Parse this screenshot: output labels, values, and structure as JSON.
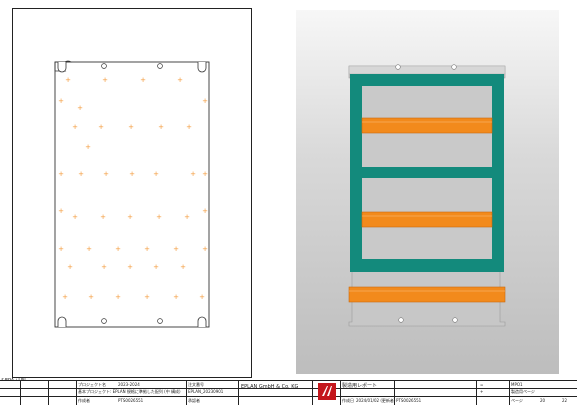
{
  "drawing": {
    "left_label": "&EPA+UN",
    "markers": "+"
  },
  "titleblock": {
    "col1_a": "プロジェクト名",
    "col1_b": "作成者",
    "col1_c": "部",
    "proj_name": "プロジェクト名",
    "proj_date": "2023-2024",
    "proj_desc": "基本プロジェクト: EPLAN 規格に準拠した配列 (中 構成)",
    "creator_label": "作成者",
    "creator_value": "PTS0026551",
    "approver_label": "承認者",
    "doc_id_label": "注文番号",
    "doc_id_value": "EPLAN_20230901",
    "company": "EPLAN GmbH & Co. KG",
    "doc_title": "製造用レポート",
    "date_label": "作成日",
    "date_value": "2024/01/02 (更新者)",
    "ver_label": "承認",
    "ver_value": "PTS0026551",
    "right_top": "=",
    "right_mid": "+",
    "right_page_label": "ページ",
    "right_page_value": "22",
    "right_total": "22",
    "right_code": "MPO1",
    "right_code2": "製造用ページ",
    "right_sheet_label": "シート",
    "right_sheet_value": "1",
    "right_type": "ページ",
    "right_num": "20"
  }
}
